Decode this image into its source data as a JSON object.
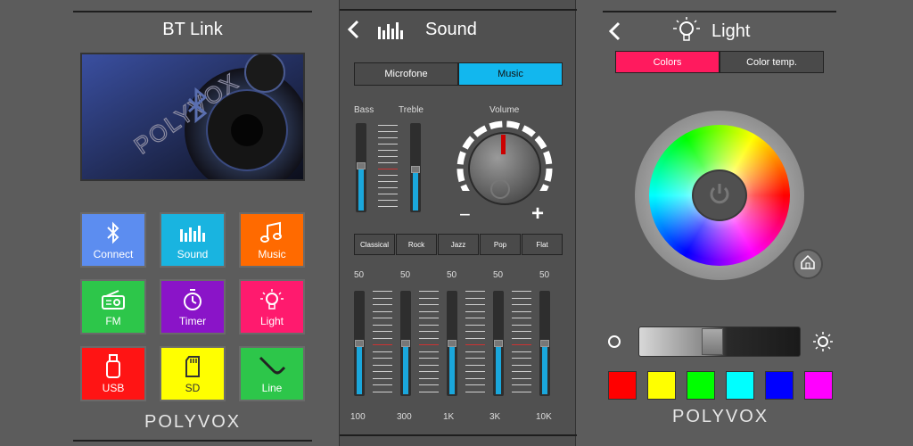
{
  "bt_panel": {
    "title": "BT Link",
    "banner_brand": "POLYVOX",
    "tiles": [
      {
        "label": "Connect",
        "icon": "bluetooth-icon",
        "color": "#5c8df0"
      },
      {
        "label": "Sound",
        "icon": "equalizer-icon",
        "color": "#19b4e0"
      },
      {
        "label": "Music",
        "icon": "music-note-icon",
        "color": "#ff6a00"
      },
      {
        "label": "FM",
        "icon": "radio-icon",
        "color": "#2dc64a"
      },
      {
        "label": "Timer",
        "icon": "timer-icon",
        "color": "#8a14c8"
      },
      {
        "label": "Light",
        "icon": "bulb-icon",
        "color": "#ff1a6e"
      },
      {
        "label": "USB",
        "icon": "usb-icon",
        "color": "#ff1414"
      },
      {
        "label": "SD",
        "icon": "sd-card-icon",
        "color": "#ffff00"
      },
      {
        "label": "Line",
        "icon": "line-cable-icon",
        "color": "#2dc64a"
      }
    ],
    "logo": "POLYVOX"
  },
  "sound_panel": {
    "title": "Sound",
    "tabs": [
      {
        "label": "Microfone",
        "active": false
      },
      {
        "label": "Music",
        "active": true
      }
    ],
    "bass_label": "Bass",
    "treble_label": "Treble",
    "volume_label": "Volume",
    "volume_minus": "−",
    "volume_plus": "+",
    "bass_level": 0.52,
    "treble_level": 0.48,
    "presets": [
      "Classical",
      "Rock",
      "Jazz",
      "Pop",
      "Flat"
    ],
    "eq_bands": [
      {
        "freq": "100",
        "value": "50",
        "level": 0.5
      },
      {
        "freq": "300",
        "value": "50",
        "level": 0.5
      },
      {
        "freq": "1K",
        "value": "50",
        "level": 0.5
      },
      {
        "freq": "3K",
        "value": "50",
        "level": 0.5
      },
      {
        "freq": "10K",
        "value": "50",
        "level": 0.5
      }
    ],
    "accent_color": "#1aa7dc"
  },
  "light_panel": {
    "title": "Light",
    "tabs": [
      {
        "label": "Colors",
        "active": true
      },
      {
        "label": "Color temp.",
        "active": false
      }
    ],
    "brightness_level": 0.45,
    "swatches": [
      "#ff0000",
      "#ffff00",
      "#00ff00",
      "#00ffff",
      "#0000ff",
      "#ff00ff"
    ],
    "logo": "POLYVOX",
    "active_tab_color": "#ff1a5e"
  }
}
